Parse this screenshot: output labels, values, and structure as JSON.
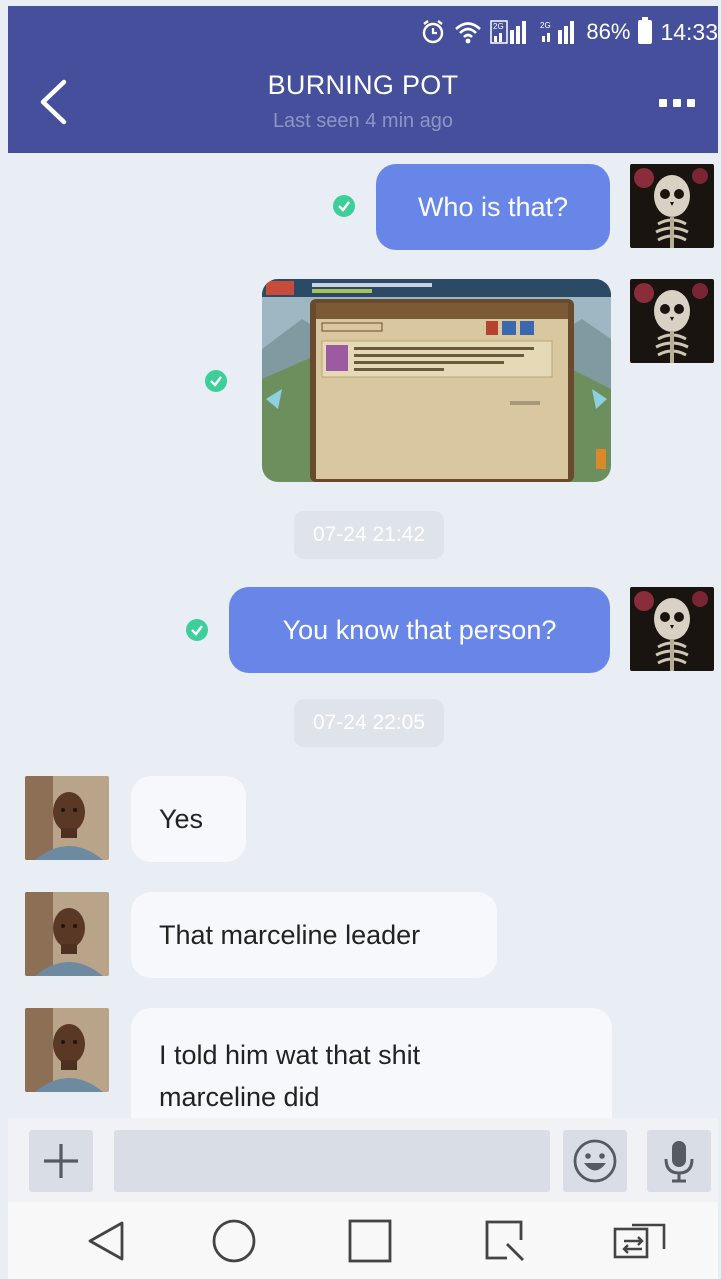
{
  "status_bar": {
    "network_1": "2G",
    "network_2": "2G",
    "battery": "86%",
    "time": "14:33",
    "icons": [
      "alarm-icon",
      "wifi-icon",
      "signal-icon",
      "signal-icon",
      "battery-icon"
    ]
  },
  "header": {
    "title": "BURNING POT",
    "subtitle": "Last seen 4 min ago",
    "back_icon": "chevron-left-icon",
    "more_icon": "more-dots-icon"
  },
  "messages": [
    {
      "direction": "out",
      "type": "text",
      "text": "Who is that?",
      "status": "delivered"
    },
    {
      "direction": "out",
      "type": "image",
      "image_desc": "game-screenshot",
      "status": "delivered"
    },
    {
      "type": "timestamp",
      "text": "07-24 21:42"
    },
    {
      "direction": "out",
      "type": "text",
      "text": "You know that person?",
      "status": "delivered"
    },
    {
      "type": "timestamp",
      "text": "07-24 22:05"
    },
    {
      "direction": "in",
      "type": "text",
      "text": "Yes"
    },
    {
      "direction": "in",
      "type": "text",
      "text": "That marceline leader"
    },
    {
      "direction": "in",
      "type": "text",
      "text": "I told him wat that shit\nmarceline did"
    }
  ],
  "input_bar": {
    "placeholder": "",
    "icons": [
      "plus-icon",
      "emoji-icon",
      "microphone-icon"
    ]
  },
  "nav_bar": {
    "icons": [
      "back-triangle-icon",
      "home-circle-icon",
      "recents-square-icon",
      "screenshot-icon",
      "switch-sim-icon"
    ]
  },
  "colors": {
    "header": "#454f9c",
    "outgoing_bubble": "#6786e8",
    "incoming_bubble": "#f7f8fc",
    "chat_background": "#e9edf4",
    "delivered_check": "#3ccf9a"
  }
}
